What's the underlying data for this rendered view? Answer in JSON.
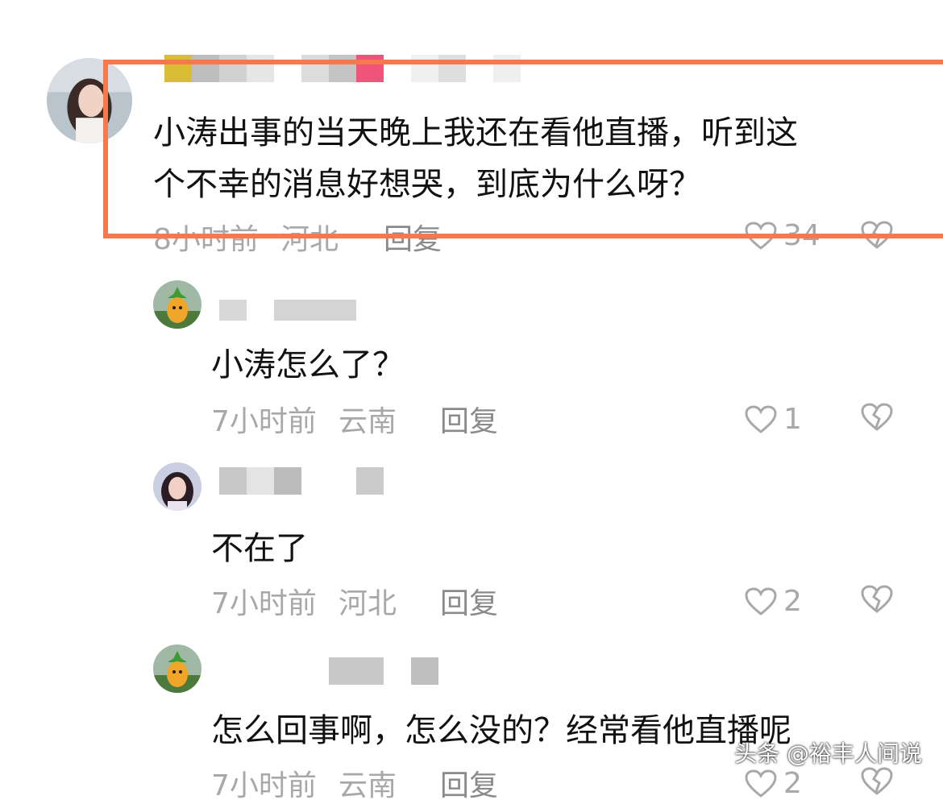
{
  "comments": [
    {
      "text_lines": [
        "小涛出事的当天晚上我还在看他直播，听到这",
        "个不幸的消息好想哭，到底为什么呀？"
      ],
      "time": "8小时前",
      "location": "河北",
      "reply_label": "回复",
      "likes": "34"
    },
    {
      "text_lines": [
        "小涛怎么了？"
      ],
      "time": "7小时前",
      "location": "云南",
      "reply_label": "回复",
      "likes": "1"
    },
    {
      "text_lines": [
        "不在了"
      ],
      "time": "7小时前",
      "location": "河北",
      "reply_label": "回复",
      "likes": "2"
    },
    {
      "text_lines": [
        "怎么回事啊，怎么没的？经常看他直播呢"
      ],
      "time": "7小时前",
      "location": "云南",
      "reply_label": "回复",
      "likes": "2"
    }
  ],
  "colors": {
    "highlight_border": "#f5794a",
    "meta_text": "#a8a8a8",
    "comment_text": "#111111"
  },
  "icons": [
    "heart-outline-icon",
    "broken-heart-icon"
  ],
  "watermark": "头条 @裕丰人间说"
}
